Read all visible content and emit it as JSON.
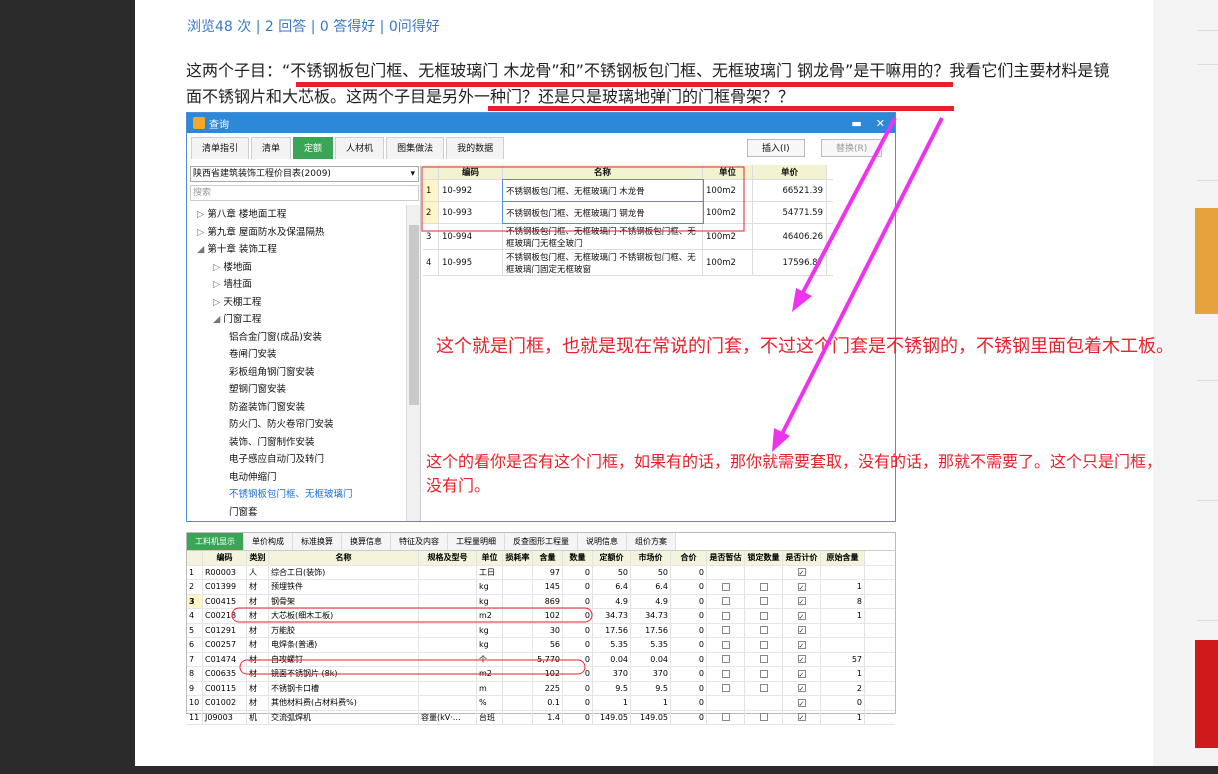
{
  "stats": {
    "text": "浏览48 次 | 2 回答 | 0 答得好 | 0问得好"
  },
  "question": {
    "text": "这两个子目：“不锈钢板包门框、无框玻璃门 木龙骨”和”不锈钢板包门框、无框玻璃门 钢龙骨”是干嘛用的？我看它们主要材料是镜面不锈钢片和大芯板。这两个子目是另外一种门？还是只是玻璃地弹门的门框骨架？？"
  },
  "window": {
    "title": "查询",
    "controls": [
      "▬",
      "✕"
    ],
    "tabs": [
      "清单指引",
      "清单",
      "定额",
      "人材机",
      "图集做法",
      "我的数据"
    ],
    "active_tab": "定额",
    "insert_button": "插入(I)",
    "replace_button": "替换(R)",
    "library_select": "陕西省建筑装饰工程价目表(2009)",
    "search_placeholder": "搜索",
    "tree": [
      {
        "indent": 1,
        "arrow": "▷",
        "label": "第八章 楼地面工程"
      },
      {
        "indent": 1,
        "arrow": "▷",
        "label": "第九章 屋面防水及保温隔热"
      },
      {
        "indent": 1,
        "arrow": "◢",
        "label": "第十章 装饰工程"
      },
      {
        "indent": 2,
        "arrow": "▷",
        "label": "楼地面"
      },
      {
        "indent": 2,
        "arrow": "▷",
        "label": "墙柱面"
      },
      {
        "indent": 2,
        "arrow": "▷",
        "label": "天棚工程"
      },
      {
        "indent": 2,
        "arrow": "◢",
        "label": "门窗工程"
      },
      {
        "indent": 3,
        "arrow": "",
        "label": "铝合金门窗(成品)安装"
      },
      {
        "indent": 3,
        "arrow": "",
        "label": "卷闸门安装"
      },
      {
        "indent": 3,
        "arrow": "",
        "label": "彩板组角钢门窗安装"
      },
      {
        "indent": 3,
        "arrow": "",
        "label": "塑钢门窗安装"
      },
      {
        "indent": 3,
        "arrow": "",
        "label": "防盗装饰门窗安装"
      },
      {
        "indent": 3,
        "arrow": "",
        "label": "防火门、防火卷帘门安装"
      },
      {
        "indent": 3,
        "arrow": "",
        "label": "装饰、门窗制作安装"
      },
      {
        "indent": 3,
        "arrow": "",
        "label": "电子感应自动门及转门"
      },
      {
        "indent": 3,
        "arrow": "",
        "label": "电动伸缩门"
      },
      {
        "indent": 3,
        "arrow": "",
        "label": "不锈钢板包门框、无框玻璃门",
        "selected": true
      },
      {
        "indent": 3,
        "arrow": "",
        "label": "门窗套"
      }
    ],
    "grid_headers": [
      "",
      "编码",
      "名称",
      "单位",
      "单价"
    ],
    "grid_rows": [
      {
        "n": "1",
        "code": "10-992",
        "name": "不锈钢板包门框、无框玻璃门 木龙骨",
        "unit": "100m2",
        "price": "66521.39"
      },
      {
        "n": "2",
        "code": "10-993",
        "name": "不锈钢板包门框、无框玻璃门 钢龙骨",
        "unit": "100m2",
        "price": "54771.59"
      },
      {
        "n": "3",
        "code": "10-994",
        "name": "不锈钢板包门框、无框玻璃门 不锈钢板包门框、无框玻璃门无框全玻门",
        "unit": "100m2",
        "price": "46406.26"
      },
      {
        "n": "4",
        "code": "10-995",
        "name": "不锈钢板包门框、无框玻璃门 不锈钢板包门框、无框玻璃门固定无框玻窗",
        "unit": "100m2",
        "price": "17596.87"
      }
    ]
  },
  "bottom": {
    "tabs": [
      "工料机显示",
      "单价构成",
      "标准换算",
      "换算信息",
      "特征及内容",
      "工程量明细",
      "反查图形工程量",
      "说明信息",
      "组价方案"
    ],
    "headers": [
      "",
      "编码",
      "类别",
      "名称",
      "规格及型号",
      "单位",
      "损耗率",
      "含量",
      "数量",
      "定额价",
      "市场价",
      "合价",
      "是否暂估",
      "锁定数量",
      "是否计价",
      "原始含量"
    ],
    "rows": [
      [
        "1",
        "R00003",
        "人",
        "综合工日(装饰)",
        "",
        "工日",
        "",
        "97",
        "0",
        "50",
        "50",
        "0",
        "",
        "",
        "y",
        ""
      ],
      [
        "2",
        "C01399",
        "材",
        "预埋铁件",
        "",
        "kg",
        "",
        "145",
        "0",
        "6.4",
        "6.4",
        "0",
        "n",
        "n",
        "y",
        "1"
      ],
      [
        "3",
        "C00415",
        "材",
        "钢骨架",
        "",
        "kg",
        "",
        "869",
        "0",
        "4.9",
        "4.9",
        "0",
        "n",
        "n",
        "y",
        "8"
      ],
      [
        "4",
        "C00218",
        "材",
        "大芯板(细木工板)",
        "",
        "m2",
        "",
        "102",
        "0",
        "34.73",
        "34.73",
        "0",
        "n",
        "n",
        "y",
        "1"
      ],
      [
        "5",
        "C01291",
        "材",
        "万能胶",
        "",
        "kg",
        "",
        "30",
        "0",
        "17.56",
        "17.56",
        "0",
        "n",
        "n",
        "y",
        ""
      ],
      [
        "6",
        "C00257",
        "材",
        "电焊条(普通)",
        "",
        "kg",
        "",
        "56",
        "0",
        "5.35",
        "5.35",
        "0",
        "n",
        "n",
        "y",
        ""
      ],
      [
        "7",
        "C01474",
        "材",
        "自攻螺钉",
        "",
        "个",
        "",
        "5,770",
        "0",
        "0.04",
        "0.04",
        "0",
        "n",
        "n",
        "y",
        "57"
      ],
      [
        "8",
        "C00635",
        "材",
        "镜面不锈钢片 (8k)",
        "",
        "m2",
        "",
        "102",
        "0",
        "370",
        "370",
        "0",
        "n",
        "n",
        "y",
        "1"
      ],
      [
        "9",
        "C00115",
        "材",
        "不锈钢卡口槽",
        "",
        "m",
        "",
        "225",
        "0",
        "9.5",
        "9.5",
        "0",
        "n",
        "n",
        "y",
        "2"
      ],
      [
        "10",
        "C01002",
        "材",
        "其他材料费(占材料费%)",
        "",
        "%",
        "",
        "0.1",
        "0",
        "1",
        "1",
        "0",
        "",
        "",
        "y",
        "0"
      ],
      [
        "11",
        "J09003",
        "机",
        "交流弧焊机",
        "容量(kV·…",
        "台班",
        "",
        "1.4",
        "0",
        "149.05",
        "149.05",
        "0",
        "n",
        "n",
        "y",
        "1"
      ]
    ]
  },
  "annotations": {
    "a1": "这个就是门框，也就是现在常说的门套，不过这个门套是不锈钢的，不锈钢里面包着木工板。",
    "a2": "这个的看你是否有这个门框，如果有的话，那你就需要套取，没有的话，那就不需要了。这个只是门框，没有门。"
  },
  "colors": {
    "accent_red": "#e8212b",
    "arrow_magenta": "#ee33ee",
    "tab_green": "#3aa655",
    "title_blue": "#2e88d8"
  }
}
